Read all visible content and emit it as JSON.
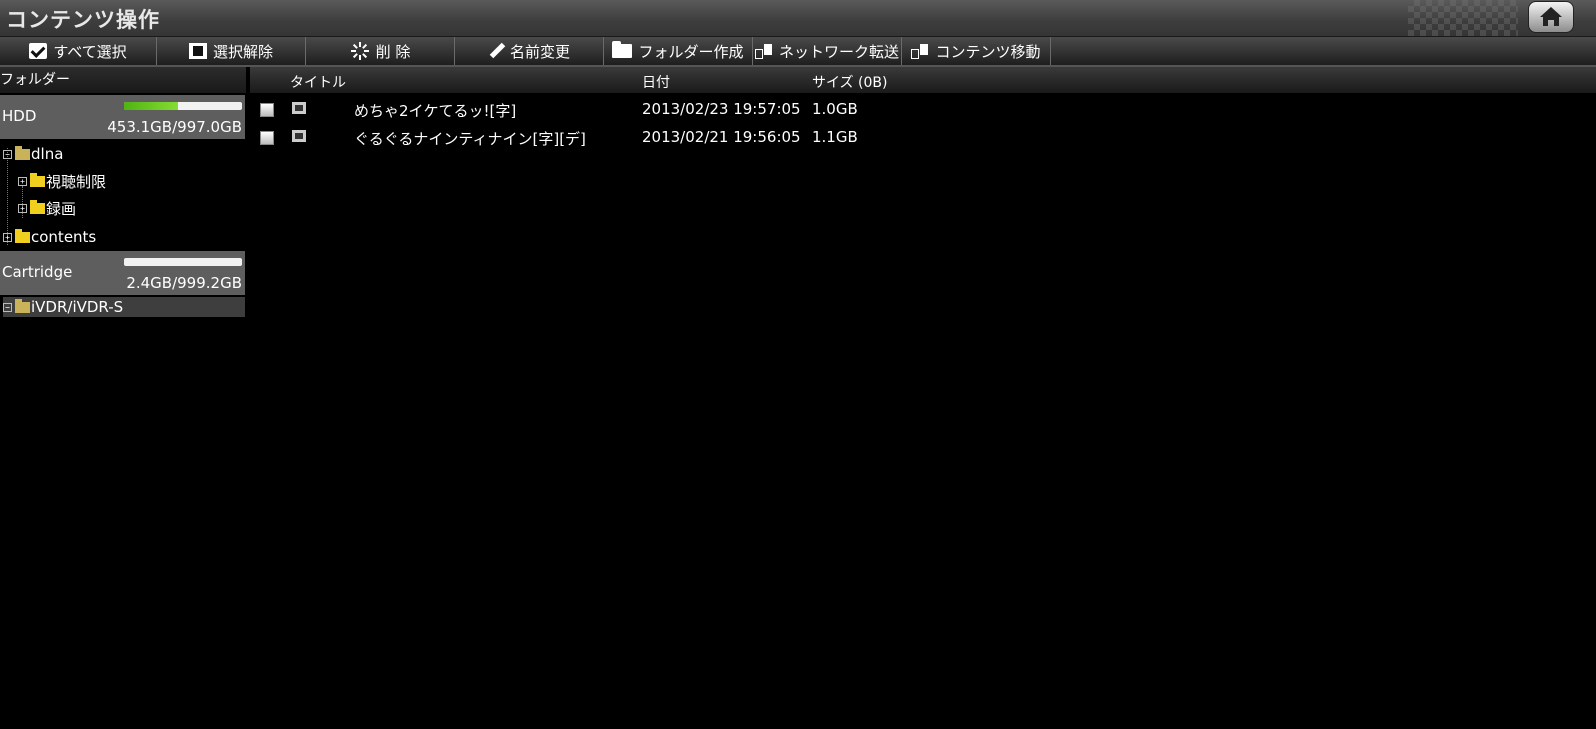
{
  "app": {
    "title": "コンテンツ操作"
  },
  "toolbar": {
    "select_all": "すべて選択",
    "deselect": "選択解除",
    "delete": "削 除",
    "rename": "名前変更",
    "create_folder": "フォルダー作成",
    "network_transfer": "ネットワーク転送",
    "move_contents": "コンテンツ移動"
  },
  "sidebar": {
    "header": "フォルダー",
    "drives": [
      {
        "name": "HDD",
        "capacity": "453.1GB/997.0GB",
        "used_fraction": 0.454
      },
      {
        "name": "Cartridge",
        "capacity": "2.4GB/999.2GB",
        "used_fraction": 0.002
      }
    ],
    "tree": {
      "dlna": "dlna",
      "restriction": "視聴制限",
      "recording": "録画",
      "contents": "contents",
      "ivdr": "iVDR/iVDR-S"
    }
  },
  "table": {
    "headers": {
      "title": "タイトル",
      "date": "日付",
      "size": "サイズ (0B)"
    },
    "rows": [
      {
        "title": "めちゃ2イケてるッ![字]",
        "date": "2013/02/23 19:57:05",
        "size": "1.0GB"
      },
      {
        "title": "ぐるぐるナインティナイン[字][デ]",
        "date": "2013/02/21 19:56:05",
        "size": "1.1GB"
      }
    ]
  },
  "colors": {
    "usage_green": "#6ccb24",
    "folder_yellow": "#f0cf1f",
    "selected_drive": "#5e5e5e"
  },
  "icons": [
    "home-icon",
    "check-icon",
    "square-icon",
    "spinner-icon",
    "pencil-icon",
    "folder-icon",
    "devices-icon",
    "film-icon"
  ]
}
